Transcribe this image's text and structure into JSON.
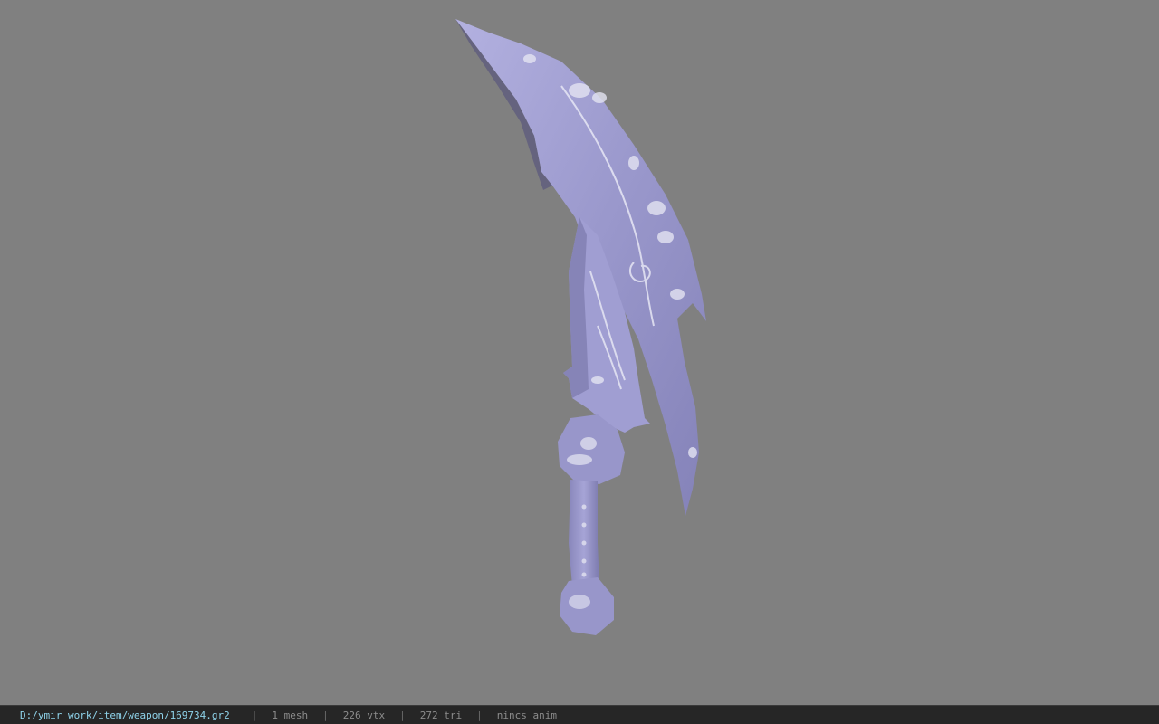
{
  "viewport": {
    "background": "#808080",
    "model_tint": "#9a98cc"
  },
  "status": {
    "path": "D:/ymir work/item/weapon/169734.gr2",
    "mesh": "1 mesh",
    "vtx": "226 vtx",
    "tri": "272 tri",
    "anim": "nincs anim",
    "separator": "|",
    "path_color": "#8fd3ea"
  }
}
